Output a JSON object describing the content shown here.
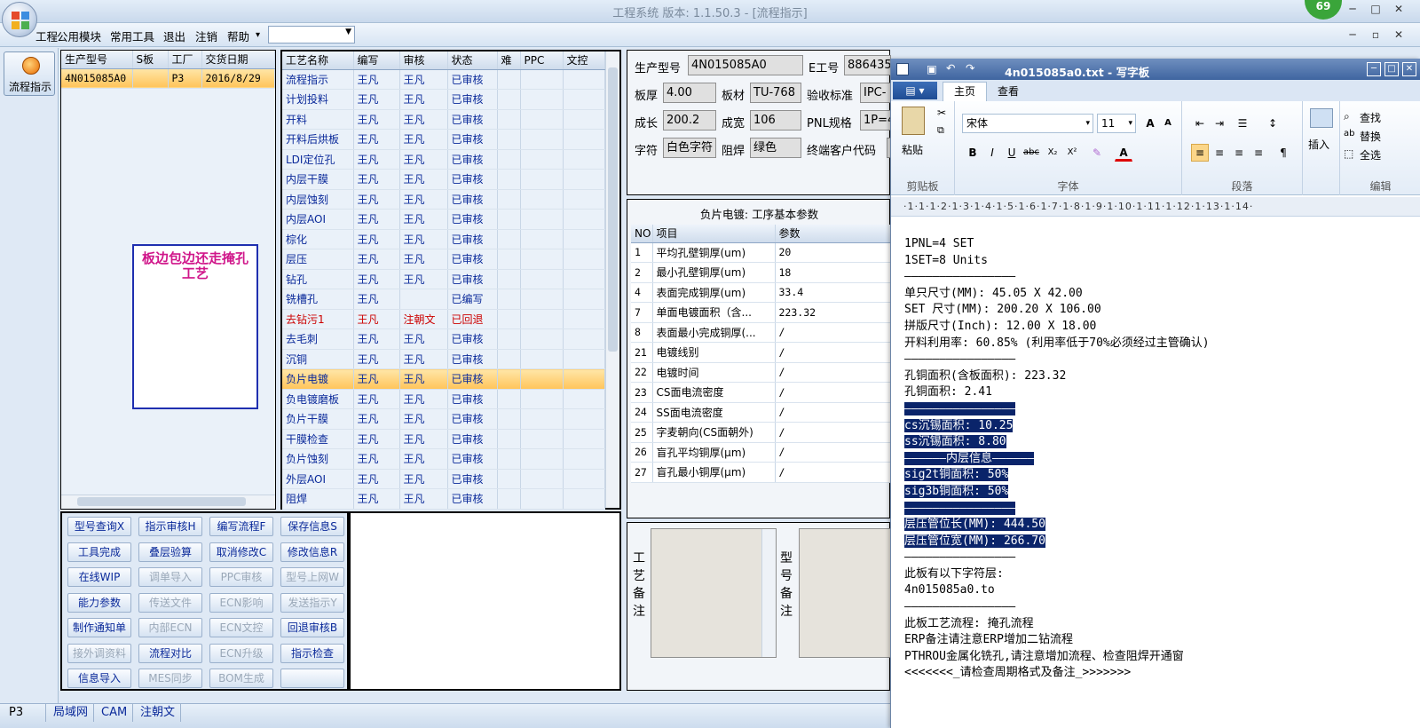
{
  "window": {
    "title": "工程系统   版本: 1.1.50.3 - [流程指示]",
    "badge": "69",
    "controls": [
      "─",
      "□",
      "✕"
    ],
    "mdi_controls": [
      "─",
      "▫",
      "✕"
    ]
  },
  "menu": {
    "items": [
      "工程",
      "公用模块",
      "常用工具",
      "退出",
      "注销",
      "帮助"
    ],
    "help_arrow": "▾",
    "combo_value": ""
  },
  "left_strip": {
    "flow_button": "流程指示"
  },
  "order_grid": {
    "headers": [
      "生产型号",
      "S板",
      "工厂",
      "交货日期"
    ],
    "rows": [
      [
        "4N015085A0",
        "",
        "P3",
        "2016/8/29"
      ]
    ],
    "note": "板边包边还走掩孔工艺"
  },
  "process_grid": {
    "headers": [
      "工艺名称",
      "编写",
      "审核",
      "状态",
      "难",
      "PPC",
      "文控"
    ],
    "rows": [
      {
        "name": "流程指示",
        "writer": "王凡",
        "reviewer": "王凡",
        "status": "已审核"
      },
      {
        "name": "计划投料",
        "writer": "王凡",
        "reviewer": "王凡",
        "status": "已审核"
      },
      {
        "name": "开料",
        "writer": "王凡",
        "reviewer": "王凡",
        "status": "已审核"
      },
      {
        "name": "开料后烘板",
        "writer": "王凡",
        "reviewer": "王凡",
        "status": "已审核"
      },
      {
        "name": "LDI定位孔",
        "writer": "王凡",
        "reviewer": "王凡",
        "status": "已审核"
      },
      {
        "name": "内层干膜",
        "writer": "王凡",
        "reviewer": "王凡",
        "status": "已审核"
      },
      {
        "name": "内层蚀刻",
        "writer": "王凡",
        "reviewer": "王凡",
        "status": "已审核"
      },
      {
        "name": "内层AOI",
        "writer": "王凡",
        "reviewer": "王凡",
        "status": "已审核"
      },
      {
        "name": "棕化",
        "writer": "王凡",
        "reviewer": "王凡",
        "status": "已审核"
      },
      {
        "name": "层压",
        "writer": "王凡",
        "reviewer": "王凡",
        "status": "已审核"
      },
      {
        "name": "钻孔",
        "writer": "王凡",
        "reviewer": "王凡",
        "status": "已审核"
      },
      {
        "name": "铣槽孔",
        "writer": "王凡",
        "reviewer": "",
        "status": "已编写"
      },
      {
        "name": "去钻污1",
        "writer": "王凡",
        "reviewer": "注朝文",
        "status": "已回退"
      },
      {
        "name": "去毛刺",
        "writer": "王凡",
        "reviewer": "王凡",
        "status": "已审核"
      },
      {
        "name": "沉铜",
        "writer": "王凡",
        "reviewer": "王凡",
        "status": "已审核"
      },
      {
        "name": "负片电镀",
        "writer": "王凡",
        "reviewer": "王凡",
        "status": "已审核"
      },
      {
        "name": "负电镀磨板",
        "writer": "王凡",
        "reviewer": "王凡",
        "status": "已审核"
      },
      {
        "name": "负片干膜",
        "writer": "王凡",
        "reviewer": "王凡",
        "status": "已审核"
      },
      {
        "name": "干膜检查",
        "writer": "王凡",
        "reviewer": "王凡",
        "status": "已审核"
      },
      {
        "name": "负片蚀刻",
        "writer": "王凡",
        "reviewer": "王凡",
        "status": "已审核"
      },
      {
        "name": "外层AOI",
        "writer": "王凡",
        "reviewer": "王凡",
        "status": "已审核"
      },
      {
        "name": "阻焊",
        "writer": "王凡",
        "reviewer": "王凡",
        "status": "已审核"
      }
    ],
    "selected_index": 15,
    "rejected_index": 12
  },
  "function_buttons": [
    {
      "label": "型号查询X",
      "enabled": true
    },
    {
      "label": "指示审核H",
      "enabled": true
    },
    {
      "label": "编写流程F",
      "enabled": true
    },
    {
      "label": "保存信息S",
      "enabled": true
    },
    {
      "label": "工具完成",
      "enabled": true
    },
    {
      "label": "叠层验算",
      "enabled": true
    },
    {
      "label": "取消修改C",
      "enabled": true
    },
    {
      "label": "修改信息R",
      "enabled": true
    },
    {
      "label": "在线WIP",
      "enabled": true
    },
    {
      "label": "调单导入",
      "enabled": false
    },
    {
      "label": "PPC审核",
      "enabled": false
    },
    {
      "label": "型号上网W",
      "enabled": false
    },
    {
      "label": "能力参数",
      "enabled": true
    },
    {
      "label": "传送文件",
      "enabled": false
    },
    {
      "label": "ECN影响",
      "enabled": false
    },
    {
      "label": "发送指示Y",
      "enabled": false
    },
    {
      "label": "制作通知单",
      "enabled": true
    },
    {
      "label": "内部ECN",
      "enabled": false
    },
    {
      "label": "ECN文控",
      "enabled": false
    },
    {
      "label": "回退审核B",
      "enabled": true
    },
    {
      "label": "接外调资料",
      "enabled": false
    },
    {
      "label": "流程对比",
      "enabled": true
    },
    {
      "label": "ECN升级",
      "enabled": false
    },
    {
      "label": "指示检查",
      "enabled": true
    },
    {
      "label": "信息导入",
      "enabled": true
    },
    {
      "label": "MES同步",
      "enabled": false
    },
    {
      "label": "BOM生成",
      "enabled": false
    },
    {
      "label": "",
      "enabled": true
    }
  ],
  "info_form": {
    "prod_model_label": "生产型号",
    "prod_model": "4N015085A0",
    "e_no_label": "E工号",
    "e_no": "886435",
    "thickness_label": "板厚",
    "thickness": "4.00",
    "material_label": "板材",
    "material": "TU-768",
    "standard_label": "验收标准",
    "standard": "IPC-",
    "length_label": "成长",
    "length": "200.2",
    "width_label": "成宽",
    "width": "106",
    "pnl_label": "PNL规格",
    "pnl": "1P=4",
    "char_label": "字符",
    "char": "白色字符",
    "mask_label": "阻焊",
    "mask": "绿色",
    "customer_label": "终端客户代码",
    "customer": ""
  },
  "param_grid": {
    "title": "负片电镀: 工序基本参数",
    "headers": [
      "NO",
      "项目",
      "参数"
    ],
    "rows": [
      [
        "1",
        "平均孔壁铜厚(um)",
        "20"
      ],
      [
        "2",
        "最小孔壁铜厚(um)",
        "18"
      ],
      [
        "4",
        "表面完成铜厚(um)",
        "33.4"
      ],
      [
        "7",
        "单面电镀面积（含...",
        "223.32"
      ],
      [
        "8",
        "表面最小完成铜厚(...",
        "/"
      ],
      [
        "21",
        "电镀线别",
        "/"
      ],
      [
        "22",
        "电镀时间",
        "/"
      ],
      [
        "23",
        "CS面电流密度",
        "/"
      ],
      [
        "24",
        "SS面电流密度",
        "/"
      ],
      [
        "25",
        "字麦朝向(CS面朝外)",
        "/"
      ],
      [
        "26",
        "盲孔平均铜厚(μm)",
        "/"
      ],
      [
        "27",
        "盲孔最小铜厚(μm)",
        "/"
      ]
    ]
  },
  "remarks": {
    "process_label": "工艺备注",
    "model_label": "型号备注"
  },
  "status_tabs": [
    "P3",
    "局域网",
    "CAM",
    "注朝文"
  ],
  "wordpad": {
    "title": "4n015085a0.txt - 写字板",
    "tabs": [
      "主页",
      "查看"
    ],
    "clipboard": {
      "paste": "粘贴",
      "caption": "剪贴板"
    },
    "font": {
      "name": "宋体",
      "size": "11",
      "caption": "字体"
    },
    "paragraph_caption": "段落",
    "insert": {
      "label": "插入",
      "caption": ""
    },
    "edit": {
      "find": "查找",
      "replace": "替换",
      "select_all": "全选",
      "caption": "编辑"
    },
    "ruler": "·1·1·1·2·1·3·1·4·1·5·1·6·1·7·1·8·1·9·1·10·1·11·1·12·1·13·1·14·",
    "lines": [
      {
        "text": "1PNL=4 SET",
        "hl": false
      },
      {
        "text": "1SET=8 Units",
        "hl": false
      },
      {
        "text": "————————————————",
        "hl": false
      },
      {
        "text": "单只尺寸(MM): 45.05 X 42.00",
        "hl": false
      },
      {
        "text": "SET 尺寸(MM): 200.20 X 106.00",
        "hl": false
      },
      {
        "text": "拼版尺寸(Inch): 12.00 X 18.00",
        "hl": false
      },
      {
        "text": "开料利用率: 60.85% (利用率低于70%必须经过主管确认)",
        "hl": false
      },
      {
        "text": "————————————————",
        "hl": false
      },
      {
        "text": "孔铜面积(含板面积): 223.32",
        "hl": false
      },
      {
        "text": "孔铜面积: 2.41",
        "hl": false
      },
      {
        "text": "————————————————",
        "hl": true
      },
      {
        "text": "cs沉锡面积: 10.25",
        "hl": true
      },
      {
        "text": "ss沉锡面积: 8.80",
        "hl": true
      },
      {
        "text": "——————内层信息——————",
        "hl": true
      },
      {
        "text": "sig2t铜面积: 50%",
        "hl": true
      },
      {
        "text": "sig3b铜面积: 50%",
        "hl": true
      },
      {
        "text": "————————————————",
        "hl": true
      },
      {
        "text": "层压管位长(MM): 444.50",
        "hl": true
      },
      {
        "text": "层压管位宽(MM): 266.70",
        "hl": true
      },
      {
        "text": "————————————————",
        "hl": false
      },
      {
        "text": "此板有以下字符层:",
        "hl": false
      },
      {
        "text": "4n015085a0.to",
        "hl": false
      },
      {
        "text": "————————————————",
        "hl": false
      },
      {
        "text": "此板工艺流程: 掩孔流程",
        "hl": false
      },
      {
        "text": "ERP备注请注意ERP增加二钻流程",
        "hl": false
      },
      {
        "text": "PTHROU金属化铣孔,请注意增加流程、检查阻焊开通窗",
        "hl": false
      },
      {
        "text": "<<<<<<<_请检查周期格式及备注_>>>>>>>",
        "hl": false
      }
    ]
  },
  "colors": {
    "accent": "#0b2a9a",
    "selection": "#ffc45a",
    "rejected": "#cc0000",
    "highlight": "#0a246a"
  }
}
